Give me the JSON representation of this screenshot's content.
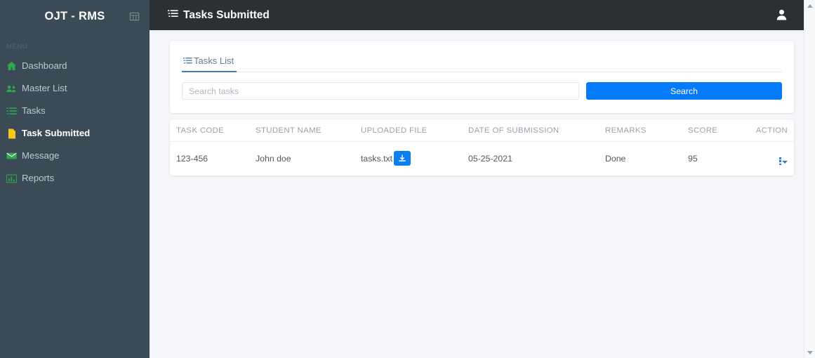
{
  "colors": {
    "sidebar_bg": "#3a4b55",
    "topbar_bg": "#2c3035",
    "content_bg": "#f4f6f9",
    "accent_blue": "#057bfc",
    "tab_underline": "#3d7fb5",
    "icon_green": "#2fa84f",
    "icon_yellow": "#f5c518",
    "action_blue": "#2b7fd4"
  },
  "sidebar": {
    "brand": "OJT - RMS",
    "toggle_icon": "grid-toggle-icon",
    "menu_label": "MENU",
    "items": [
      {
        "label": "Dashboard",
        "icon": "home-icon",
        "active": false
      },
      {
        "label": "Master List",
        "icon": "users-icon",
        "active": false
      },
      {
        "label": "Tasks",
        "icon": "list-icon",
        "active": false
      },
      {
        "label": "Task Submitted",
        "icon": "file-icon",
        "active": true
      },
      {
        "label": "Message",
        "icon": "envelope-icon",
        "active": false
      },
      {
        "label": "Reports",
        "icon": "bar-chart-icon",
        "active": false
      }
    ]
  },
  "topbar": {
    "title": "Tasks Submitted",
    "title_icon": "tasks-list-icon",
    "user_icon": "user-icon"
  },
  "search_card": {
    "tab_label": "Tasks List",
    "tab_icon": "list-icon",
    "search_placeholder": "Search tasks",
    "search_value": "",
    "search_button": "Search"
  },
  "table": {
    "columns": [
      "TASK CODE",
      "STUDENT NAME",
      "UPLOADED FILE",
      "DATE OF SUBMISSION",
      "REMARKS",
      "SCORE",
      "ACTION"
    ],
    "rows": [
      {
        "task_code": "123-456",
        "student_name": "John doe",
        "uploaded_file": "tasks.txt",
        "download_icon": "download-icon",
        "date_of_submission": "05-25-2021",
        "remarks": "Done",
        "score": "95",
        "action_icon": "kebab-menu-icon"
      }
    ]
  },
  "scrollbar": {
    "up_icon": "scroll-up-arrow-icon",
    "down_icon": "scroll-down-arrow-icon"
  }
}
